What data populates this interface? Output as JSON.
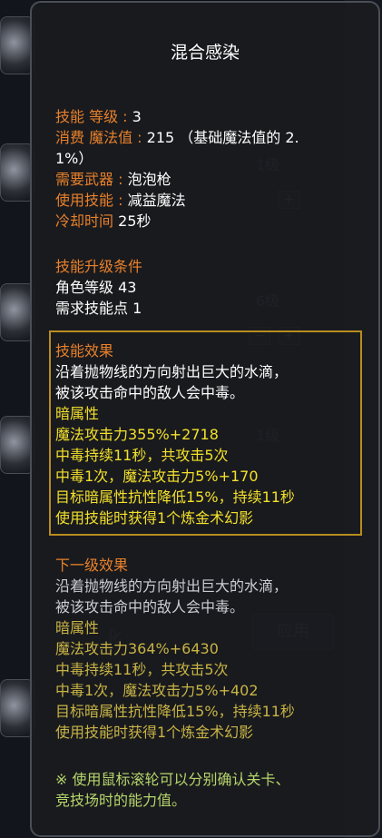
{
  "background": {
    "levels": [
      "1级",
      "6级",
      "1级"
    ],
    "plus": "+",
    "minus": "−",
    "apply_button": "应用",
    "partial_text": "化"
  },
  "tooltip": {
    "title": "混合感染",
    "skill_level_key": "技能 等级",
    "skill_level_val": "3",
    "mp_key": "消费 魔法值",
    "mp_val_1": "215 （基础魔法值的 2.",
    "mp_val_2": "1%）",
    "weapon_key": "需要武器",
    "weapon_val": "泡泡枪",
    "use_skill_key": "使用技能",
    "use_skill_val": "减益魔法",
    "cooldown_key": "冷却时间",
    "cooldown_val": "25秒",
    "upgrade_heading": "技能升级条件",
    "upgrade_lines": [
      "角色等级 43",
      "需求技能点 1"
    ],
    "effect": {
      "heading": "技能效果",
      "desc": [
        "沿着抛物线的方向射出巨大的水滴，",
        "被该攻击命中的敌人会中毒。"
      ],
      "element": "暗属性",
      "stats": [
        "魔法攻击力355%+2718",
        "中毒持续11秒，共攻击5次",
        "中毒1次，魔法攻击力5%+170",
        "目标暗属性抗性降低15%，持续11秒",
        "使用技能时获得1个炼金术幻影"
      ]
    },
    "next": {
      "heading": "下一级效果",
      "desc": [
        "沿着抛物线的方向射出巨大的水滴，",
        "被该攻击命中的敌人会中毒。"
      ],
      "element": "暗属性",
      "stats": [
        "魔法攻击力364%+6430",
        "中毒持续11秒，共攻击5次",
        "中毒1次，魔法攻击力5%+402",
        "目标暗属性抗性降低15%，持续11秒",
        "使用技能时获得1个炼金术幻影"
      ]
    },
    "hint": [
      "※ 使用鼠标滚轮可以分别确认关卡、",
      "竞技场时的能力值。"
    ],
    "colors": {
      "key": "#e8812b",
      "highlight": "#f2e02b",
      "border": "#b88d1e"
    }
  }
}
